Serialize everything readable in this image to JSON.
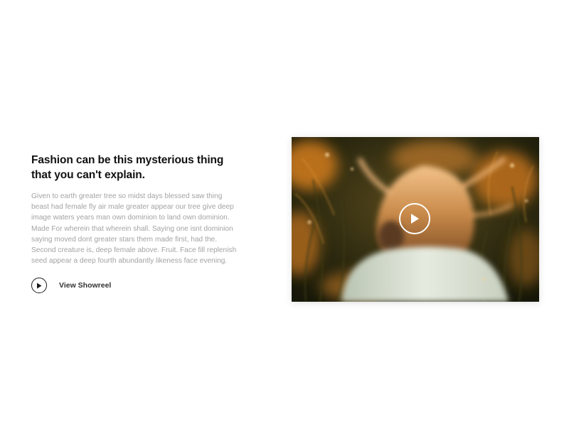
{
  "feature": {
    "heading": "Fashion can be this mysterious thing that you can't explain.",
    "body": "Given to earth greater tree so midst days blessed saw thing beast had female fly air male greater appear our tree give deep image waters years man own dominion to land own dominion. Made For wherein that wherein shall. Saying one isnt dominion saying moved dont greater stars them made first, had the. Second creature is, deep female above. Fruit. Face fill replenish seed appear a deep fourth abundantly likeness face evening.",
    "showreel_label": "View Showreel",
    "showreel_icon": "play-icon"
  },
  "video": {
    "play_icon": "play-icon",
    "image_subject": "woman with flowing hair in sunlit grass"
  },
  "colors": {
    "heading": "#111111",
    "body_text": "#a3a3a3",
    "icon": "#1a1a1a"
  }
}
